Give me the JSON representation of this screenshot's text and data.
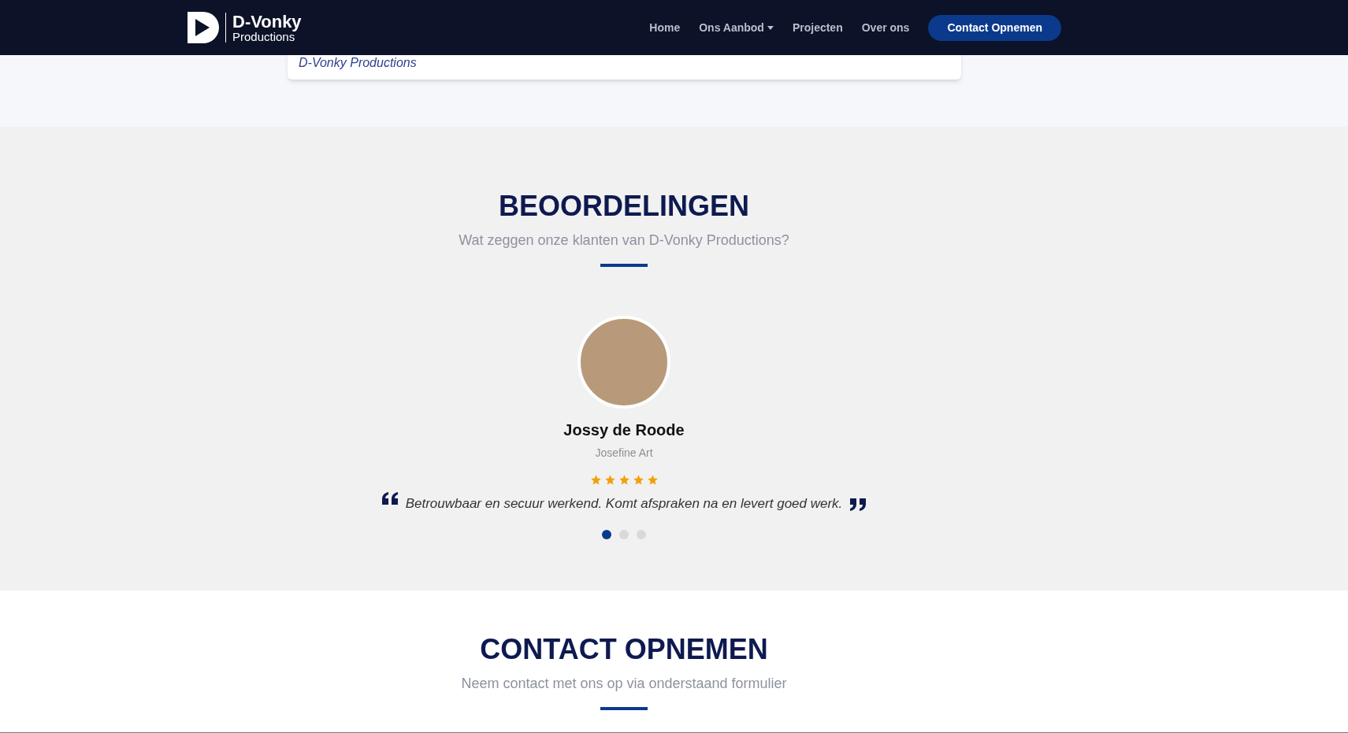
{
  "navbar": {
    "logo": {
      "title": "D-Vonky",
      "subtitle": "Productions"
    },
    "links": [
      {
        "label": "Home",
        "has_dropdown": false
      },
      {
        "label": "Ons Aanbod",
        "has_dropdown": true
      },
      {
        "label": "Projecten",
        "has_dropdown": false
      },
      {
        "label": "Over ons",
        "has_dropdown": false
      }
    ],
    "cta": "Contact Opnemen"
  },
  "card": {
    "signature": "D-Vonky Productions"
  },
  "reviews": {
    "title": "BEOORDELINGEN",
    "subtitle": "Wat zeggen onze klanten van D-Vonky Productions?",
    "testimonial": {
      "name": "Jossy de Roode",
      "company": "Josefine Art",
      "stars": 5,
      "quote": "Betrouwbaar en secuur werkend. Komt afspraken na en levert goed werk."
    },
    "slides": [
      {
        "selected": true
      },
      {
        "selected": false
      },
      {
        "selected": false
      }
    ]
  },
  "contact": {
    "title": "CONTACT OPNEMEN",
    "subtitle": "Neem contact met ons op via onderstaand formulier"
  }
}
